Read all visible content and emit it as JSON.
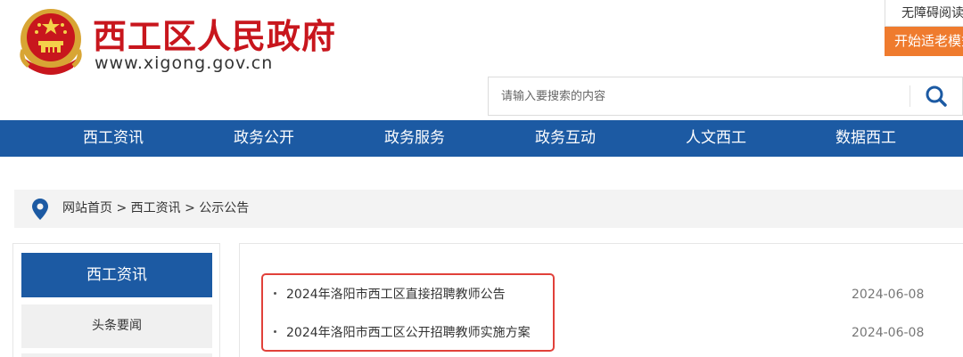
{
  "header": {
    "site_title": "西工区人民政府",
    "site_url": "www.xigong.gov.cn",
    "accessible_label": "无障碍阅读",
    "elder_mode_label": "开始适老模式"
  },
  "search": {
    "placeholder": "请输入要搜索的内容"
  },
  "nav": {
    "items": [
      "西工资讯",
      "政务公开",
      "政务服务",
      "政务互动",
      "人文西工",
      "数据西工"
    ]
  },
  "breadcrumb": {
    "text": "网站首页 > 西工资讯 > 公示公告"
  },
  "sidebar": {
    "heading": "西工资讯",
    "items": [
      "头条要闻"
    ]
  },
  "articles": [
    {
      "title": "2024年洛阳市西工区直接招聘教师公告",
      "date": "2024-06-08"
    },
    {
      "title": "2024年洛阳市西工区公开招聘教师实施方案",
      "date": "2024-06-08"
    }
  ],
  "colors": {
    "brand_red": "#c8161d",
    "nav_blue": "#1c5aa3",
    "elder_orange": "#ef7b2e",
    "highlight_red": "#e1413a"
  }
}
